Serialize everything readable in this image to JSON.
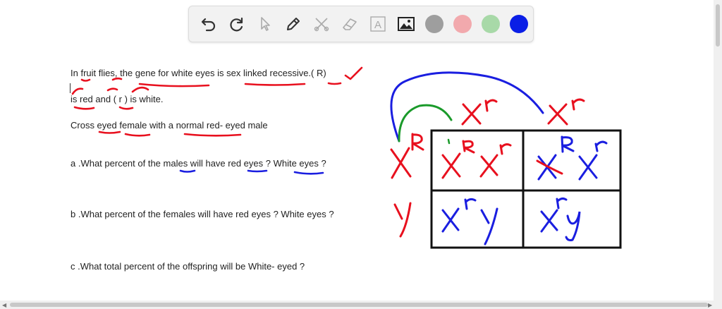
{
  "toolbar": {
    "colors": {
      "gray": "#9e9e9e",
      "pink": "#f2a9ad",
      "green": "#a8d9a8",
      "blue": "#0a1ee6"
    },
    "text_tool_label": "A"
  },
  "question": {
    "line1": "In fruit flies, the gene for white eyes is sex linked recessive.( R)",
    "line2": "is red and ( r ) is white.",
    "line3": "Cross eyed female with a normal red- eyed male",
    "qa": "a .What percent of the males will have red eyes ? White eyes ?",
    "qb": "b .What percent of the females will have red eyes ? White eyes ?",
    "qc": "c .What total percent of the offspring will be White- eyed ?"
  },
  "ink_colors": {
    "red": "#e8101e",
    "blue": "#1a1ee0",
    "green": "#1a9a2a"
  },
  "punnett": {
    "top_left_allele": "X^r",
    "top_right_allele": "X^r",
    "left_top_allele": "X^R",
    "left_bottom_allele": "Y"
  }
}
